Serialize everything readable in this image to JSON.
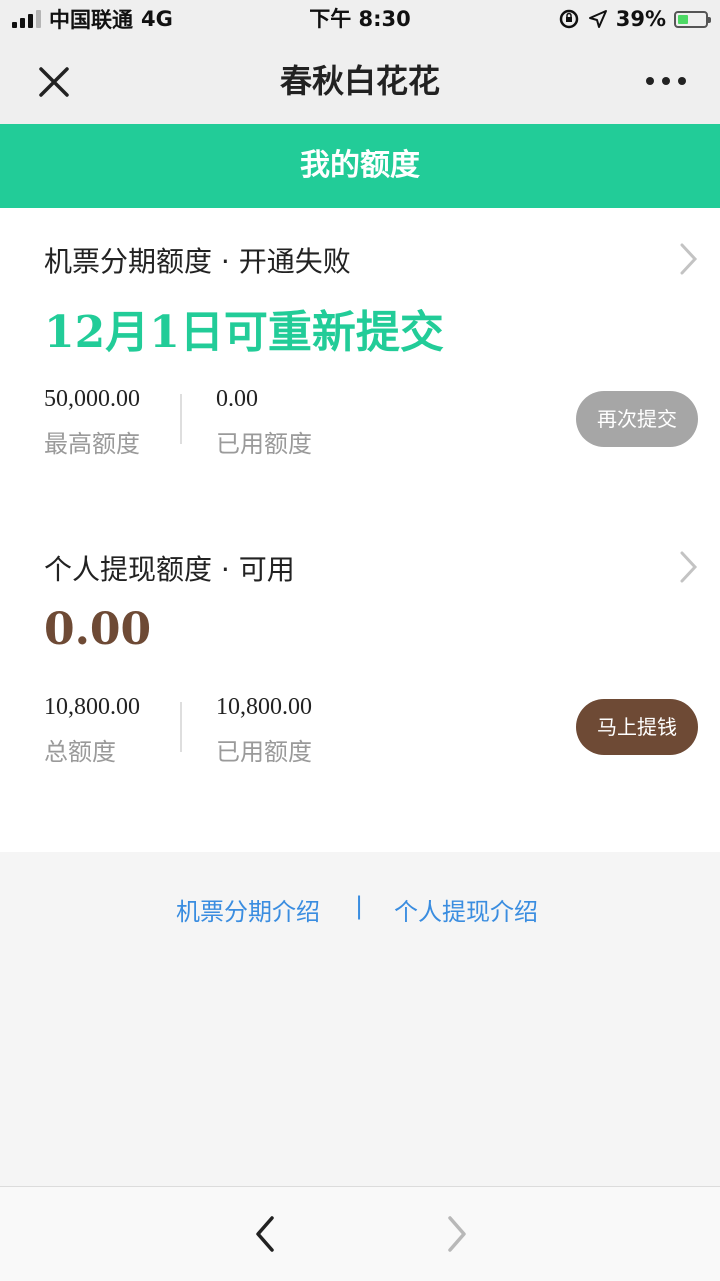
{
  "status_bar": {
    "carrier": "中国联通",
    "network": "4G",
    "time": "下午 8:30",
    "battery_pct": "39%",
    "battery_level": 0.39
  },
  "nav": {
    "title": "春秋白花花",
    "icons": [
      "close-icon",
      "more-icon"
    ]
  },
  "header": {
    "title": "我的额度"
  },
  "cards": [
    {
      "title": "机票分期额度 · 开通失败",
      "highlight": "12月1日可重新提交",
      "highlight_color": "#22cc98",
      "left_value": "50,000.00",
      "left_label": "最高额度",
      "right_value": "0.00",
      "right_label": "已用额度",
      "button": "再次提交",
      "button_color": "#a6a6a6"
    },
    {
      "title": "个人提现额度 · 可用",
      "highlight": "0.00",
      "highlight_color": "#6e4a35",
      "left_value": "10,800.00",
      "left_label": "总额度",
      "right_value": "10,800.00",
      "right_label": "已用额度",
      "button": "马上提钱",
      "button_color": "#6e4a35"
    }
  ],
  "links": {
    "left": "机票分期介绍",
    "separator": "|",
    "right": "个人提现介绍",
    "color": "#3a8de0"
  },
  "bottom_bar": {
    "icons": [
      "back-arrow-icon",
      "forward-arrow-icon"
    ]
  }
}
